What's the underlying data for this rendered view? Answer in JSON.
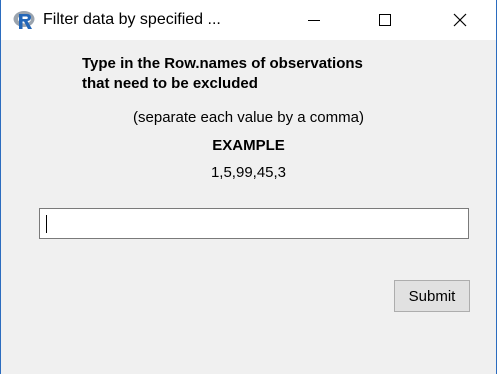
{
  "window": {
    "title": "Filter data by specified ...",
    "icon": "r-logo-icon",
    "accent_color": "#2b6cbf"
  },
  "dialog": {
    "heading_line1": "Type in the Row.names of observations",
    "heading_line2": "that need to be excluded",
    "note": "(separate each value by a comma)",
    "example_title": "EXAMPLE",
    "example_value": "1,5,99,45,3"
  },
  "input": {
    "value": "",
    "placeholder": ""
  },
  "submit": {
    "label": "Submit"
  }
}
